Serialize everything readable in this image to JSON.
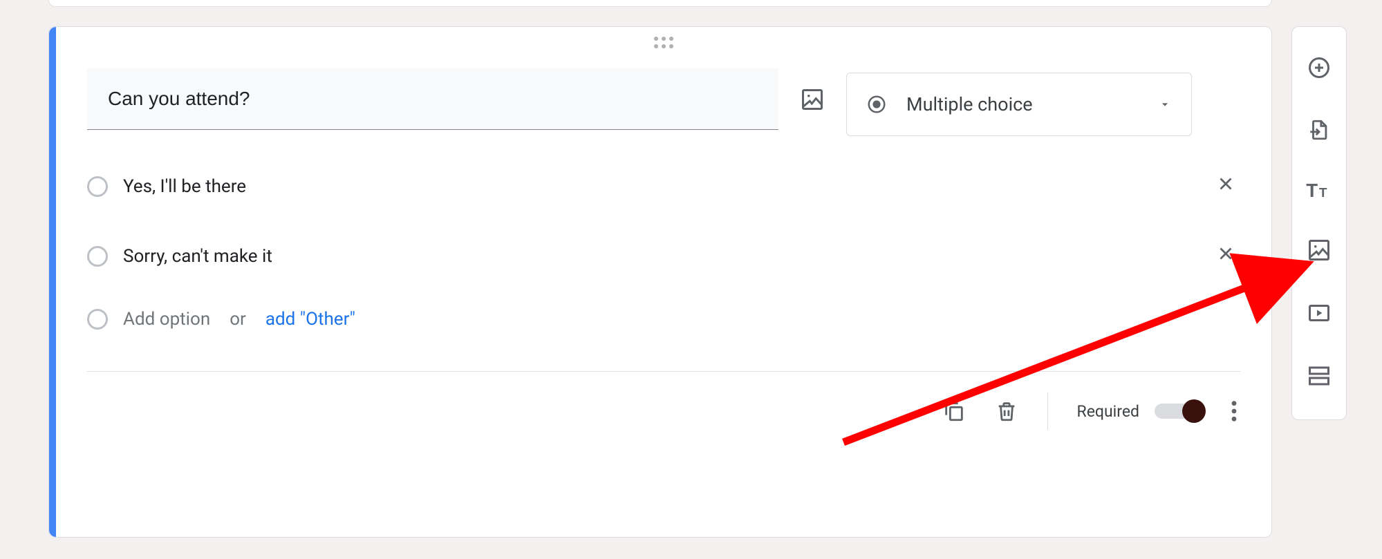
{
  "question": {
    "text": "Can you attend?",
    "type_label": "Multiple choice",
    "options": [
      "Yes,  I'll be there",
      "Sorry, can't make it"
    ],
    "add_option_placeholder": "Add option",
    "or_text": "or",
    "add_other_text": "add \"Other\""
  },
  "footer": {
    "required_label": "Required",
    "required_on": true
  },
  "side_toolbar": {
    "items": [
      "add-question",
      "import-questions",
      "add-title",
      "add-image",
      "add-video",
      "add-section"
    ]
  }
}
